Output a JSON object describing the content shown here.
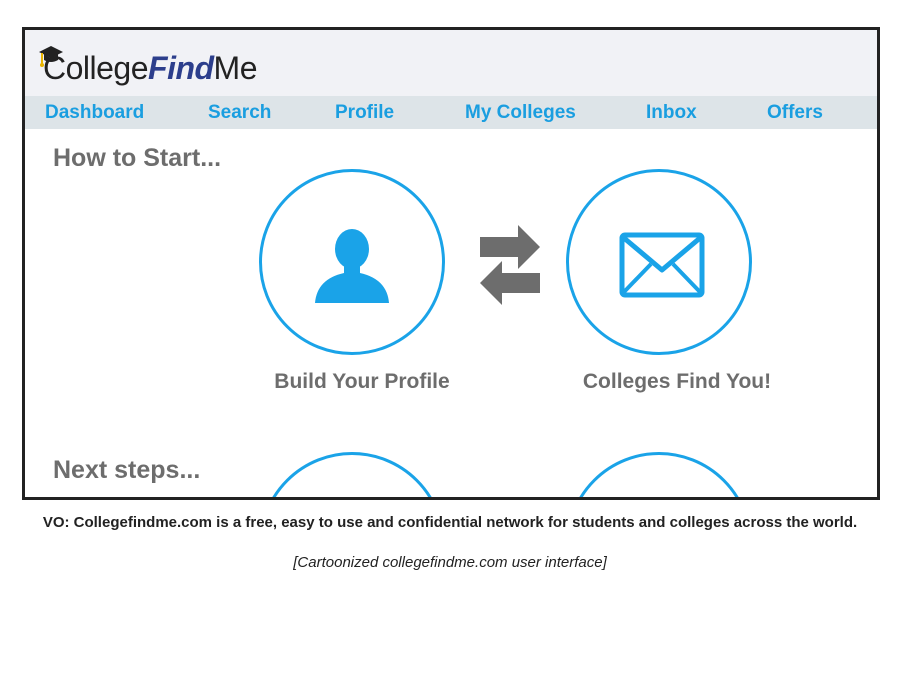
{
  "brand": {
    "name_part1": "College",
    "name_part2": "Find",
    "name_part3": "Me",
    "accent_color": "#1aa3e8",
    "logo_find_color": "#2c3e8c"
  },
  "nav": {
    "items": [
      {
        "label": "Dashboard"
      },
      {
        "label": "Search"
      },
      {
        "label": "Profile"
      },
      {
        "label": "My Colleges"
      },
      {
        "label": "Inbox"
      },
      {
        "label": "Offers"
      }
    ]
  },
  "main": {
    "how_to_start": "How to Start...",
    "steps": [
      {
        "label": "Build Your Profile",
        "icon": "user-icon"
      },
      {
        "label": "Colleges Find You!",
        "icon": "envelope-icon"
      }
    ],
    "exchange_icon": "exchange-arrows-icon",
    "next_steps": "Next steps..."
  },
  "voiceover": "VO: Collegefindme.com is a free, easy to use and confidential network for students and colleges across the world.",
  "caption": "[Cartoonized collegefindme.com user interface]"
}
